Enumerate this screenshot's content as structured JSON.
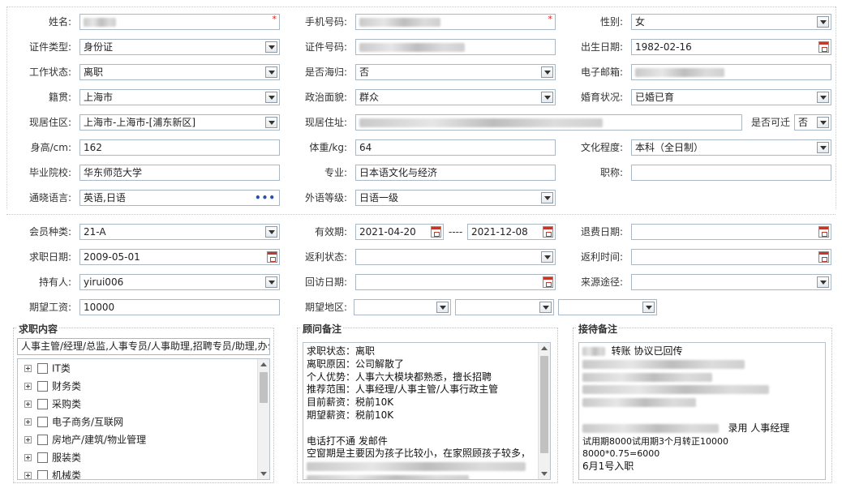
{
  "personal": {
    "name": {
      "label": "姓名:",
      "required": "*"
    },
    "mobile": {
      "label": "手机号码:",
      "required": "*"
    },
    "gender": {
      "label": "性别:",
      "value": "女"
    },
    "id_type": {
      "label": "证件类型:",
      "value": "身份证"
    },
    "id_number": {
      "label": "证件号码:"
    },
    "birth_date": {
      "label": "出生日期:",
      "value": "1982-02-16"
    },
    "work_status": {
      "label": "工作状态:",
      "value": "离职"
    },
    "returnee": {
      "label": "是否海归:",
      "value": "否"
    },
    "email": {
      "label": "电子邮箱:"
    },
    "native_place": {
      "label": "籍贯:",
      "value": "上海市"
    },
    "political": {
      "label": "政治面貌:",
      "value": "群众"
    },
    "marital": {
      "label": "婚育状况:",
      "value": "已婚已育"
    },
    "current_area": {
      "label": "现居住区:",
      "value": "上海市-上海市-[浦东新区]"
    },
    "current_address": {
      "label": "现居住址:"
    },
    "relocatable": {
      "label": "是否可迁",
      "value": "否"
    },
    "height": {
      "label": "身高/cm:",
      "value": "162"
    },
    "weight": {
      "label": "体重/kg:",
      "value": "64"
    },
    "education": {
      "label": "文化程度:",
      "value": "本科（全日制）"
    },
    "school": {
      "label": "毕业院校:",
      "value": "华东师范大学"
    },
    "major": {
      "label": "专业:",
      "value": "日本语文化与经济"
    },
    "title": {
      "label": "职称:",
      "value": ""
    },
    "languages": {
      "label": "通晓语言:",
      "value": "英语,日语",
      "more": "•••"
    },
    "foreign_level": {
      "label": "外语等级:",
      "value": "日语一级"
    }
  },
  "membership": {
    "member_type": {
      "label": "会员种类:",
      "value": "21-A"
    },
    "valid_period": {
      "label": "有效期:",
      "from": "2021-04-20",
      "separator": "----",
      "to": "2021-12-08"
    },
    "refund_date": {
      "label": "退费日期:",
      "value": ""
    },
    "job_date": {
      "label": "求职日期:",
      "value": "2009-05-01"
    },
    "rebate_status": {
      "label": "返利状态:",
      "value": ""
    },
    "rebate_time": {
      "label": "返利时间:",
      "value": ""
    },
    "holder": {
      "label": "持有人:",
      "value": "yirui006"
    },
    "visit_date": {
      "label": "回访日期:",
      "value": ""
    },
    "source": {
      "label": "来源途径:",
      "value": ""
    },
    "expected_salary": {
      "label": "期望工资:",
      "value": "10000"
    },
    "expected_area": {
      "label": "期望地区:"
    }
  },
  "job_content": {
    "title": "求职内容",
    "summary": "人事主管/经理/总监,人事专员/人事助理,招聘专员/助理,办公",
    "categories": [
      "IT类",
      "财务类",
      "采购类",
      "电子商务/互联网",
      "房地产/建筑/物业管理",
      "服装类",
      "机械类"
    ]
  },
  "consultant_notes": {
    "title": "顾问备注",
    "lines": [
      "求职状态：离职",
      "离职原因：公司解散了",
      "个人优势：人事六大模块都熟悉，擅长招聘",
      "推荐范围：人事经理/人事主管/人事行政主管",
      "目前薪资：税前10K",
      "期望薪资：税前10K",
      "",
      "电话打不通 发邮件",
      "空窗期是主要因为孩子比较小，在家照顾孩子较多，"
    ]
  },
  "reception_notes": {
    "title": "接待备注",
    "line1": "转账 协议已回传",
    "line_hire": "录用 人事经理",
    "line_probation": "试用期8000试用期3个月转正10000",
    "line_calc": "8000*0.75=6000",
    "line_start": "6月1号入职"
  },
  "colors": {
    "required": "#e02020",
    "field_border": "#aab7c4",
    "more_dots": "#2a4fa8"
  }
}
